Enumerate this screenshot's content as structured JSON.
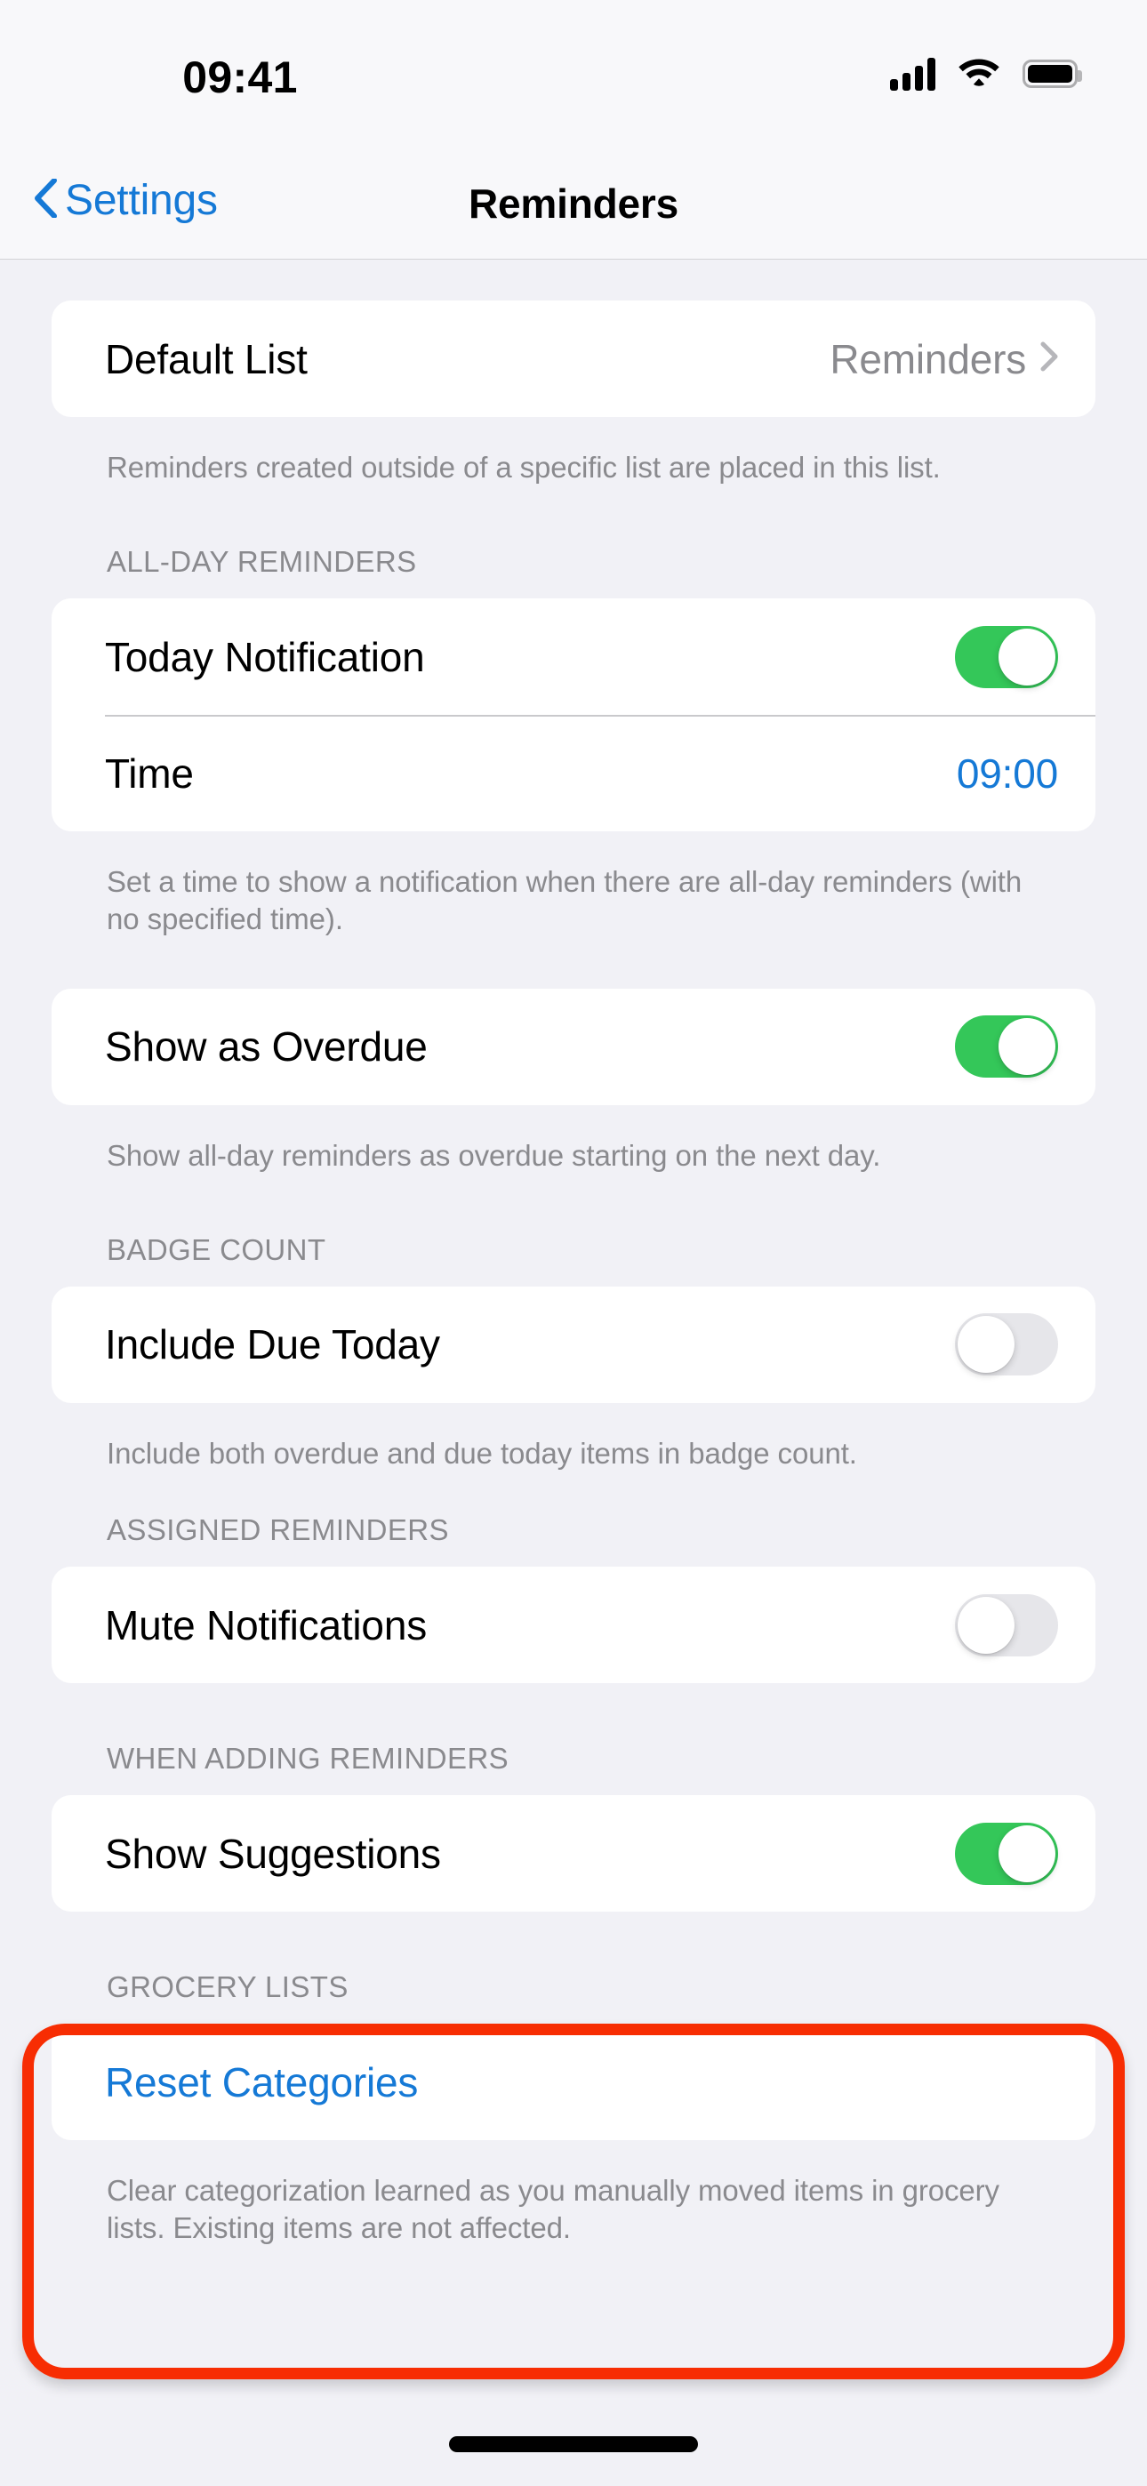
{
  "status_bar": {
    "time": "09:41",
    "cellular_icon": "cellular-signal-icon",
    "wifi_icon": "wifi-icon",
    "battery_icon": "battery-full-icon"
  },
  "nav": {
    "back_label": "Settings",
    "back_icon": "chevron-left-icon",
    "title": "Reminders"
  },
  "sections": {
    "default_list": {
      "row_label": "Default List",
      "row_value": "Reminders",
      "disclosure_icon": "chevron-right-icon",
      "footer": "Reminders created outside of a specific list are placed in this list."
    },
    "all_day_reminders": {
      "header": "ALL-DAY REMINDERS",
      "today_notification_label": "Today Notification",
      "today_notification_state": "on",
      "time_label": "Time",
      "time_value": "09:00",
      "footer": "Set a time to show a notification when there are all-day reminders (with no specified time)."
    },
    "show_overdue": {
      "label": "Show as Overdue",
      "state": "on",
      "footer": "Show all-day reminders as overdue starting on the next day."
    },
    "badge_count": {
      "header": "BADGE COUNT",
      "label": "Include Due Today",
      "state": "off",
      "footer": "Include both overdue and due today items in badge count."
    },
    "assigned_reminders": {
      "header": "ASSIGNED REMINDERS",
      "label": "Mute Notifications",
      "state": "off"
    },
    "when_adding_reminders": {
      "header": "WHEN ADDING REMINDERS",
      "label": "Show Suggestions",
      "state": "on"
    },
    "grocery_lists": {
      "header": "GROCERY LISTS",
      "action_label": "Reset Categories",
      "footer": "Clear categorization learned as you manually moved items in grocery lists. Existing items are not affected."
    }
  },
  "annotation": {
    "highlight_color": "#F72D03",
    "target": "grocery-lists-section"
  },
  "colors": {
    "accent_blue": "#1579D6",
    "toggle_on_green": "#34C759",
    "toggle_off_grey": "#E6E6EA",
    "background": "#F1F1F6",
    "card": "#FFFFFF",
    "secondary_text": "#8A8A8E"
  },
  "home_indicator": "home-indicator"
}
